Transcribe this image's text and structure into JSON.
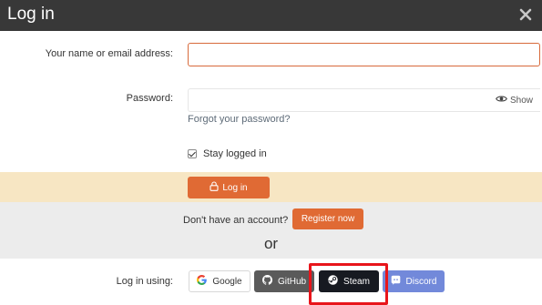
{
  "dialog": {
    "title": "Log in",
    "close_glyph": "×"
  },
  "form": {
    "name_label": "Your name or email address:",
    "name_value": "",
    "password_label": "Password:",
    "password_value": "",
    "show_label": "Show",
    "forgot_link": "Forgot your password?",
    "stay_logged_label": "Stay logged in",
    "stay_logged_checked": true,
    "login_button": "Log in"
  },
  "register": {
    "prompt": "Don't have an account?",
    "button": "Register now",
    "or_text": "or"
  },
  "providers": {
    "label": "Log in using:",
    "items": [
      {
        "label": "Google",
        "icon": "google-icon"
      },
      {
        "label": "GitHub",
        "icon": "github-icon"
      },
      {
        "label": "Steam",
        "icon": "steam-icon"
      },
      {
        "label": "Discord",
        "icon": "discord-icon"
      }
    ]
  },
  "colors": {
    "header_bg": "#383838",
    "accent": "#e06a34",
    "submit_row_bg": "#f7e6c3",
    "register_row_bg": "#ececec",
    "highlight": "#e8151b",
    "steam_bg": "#171a21",
    "github_bg": "#5a5a5a",
    "discord_bg": "#7289da"
  }
}
